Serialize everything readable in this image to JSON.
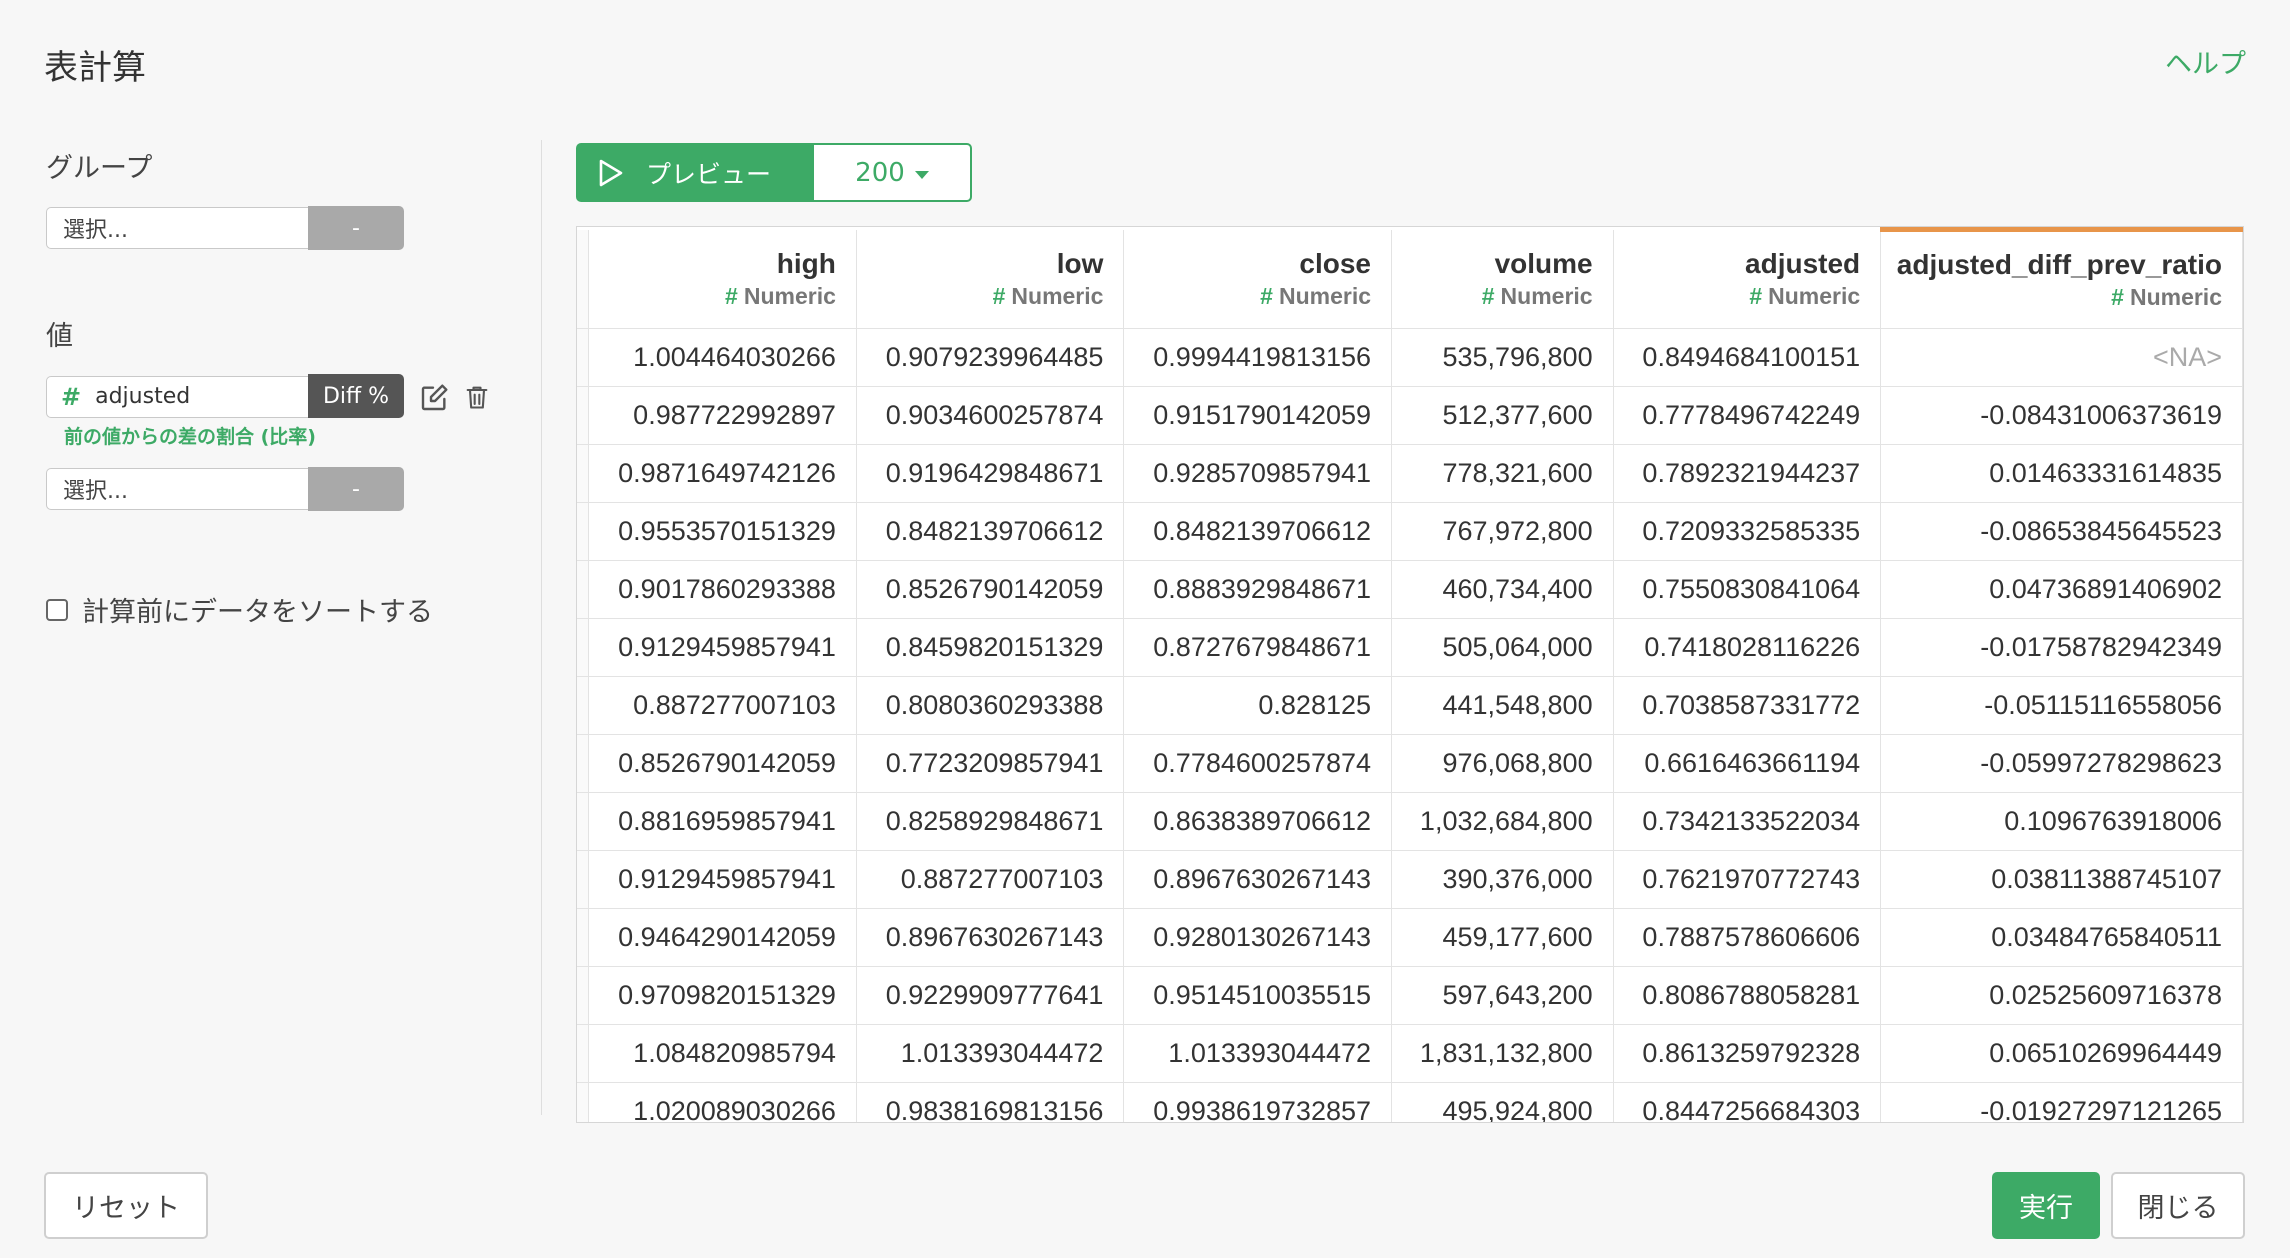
{
  "header": {
    "title": "表計算",
    "help_label": "ヘルプ"
  },
  "group": {
    "label": "グループ",
    "placeholder": "選択...",
    "button": "-"
  },
  "value": {
    "label": "値",
    "column": "adjusted",
    "calc_badge": "Diff %",
    "calc_description": "前の値からの差の割合 (比率)",
    "second_placeholder": "選択...",
    "second_button": "-"
  },
  "sort": {
    "label": "計算前にデータをソートする",
    "checked": false
  },
  "preview": {
    "button_label": "プレビュー",
    "count": "200"
  },
  "table": {
    "columns": [
      {
        "name": "high",
        "type": "Numeric"
      },
      {
        "name": "low",
        "type": "Numeric"
      },
      {
        "name": "close",
        "type": "Numeric"
      },
      {
        "name": "volume",
        "type": "Numeric"
      },
      {
        "name": "adjusted",
        "type": "Numeric"
      },
      {
        "name": "adjusted_diff_prev_ratio",
        "type": "Numeric"
      }
    ],
    "rows": [
      [
        "1.004464030266",
        "0.9079239964485",
        "0.9994419813156",
        "535,796,800",
        "0.8494684100151",
        "<NA>"
      ],
      [
        "0.987722992897",
        "0.9034600257874",
        "0.9151790142059",
        "512,377,600",
        "0.7778496742249",
        "-0.08431006373619"
      ],
      [
        "0.9871649742126",
        "0.9196429848671",
        "0.9285709857941",
        "778,321,600",
        "0.7892321944237",
        "0.01463331614835"
      ],
      [
        "0.9553570151329",
        "0.8482139706612",
        "0.8482139706612",
        "767,972,800",
        "0.7209332585335",
        "-0.08653845645523"
      ],
      [
        "0.9017860293388",
        "0.8526790142059",
        "0.8883929848671",
        "460,734,400",
        "0.7550830841064",
        "0.04736891406902"
      ],
      [
        "0.9129459857941",
        "0.8459820151329",
        "0.8727679848671",
        "505,064,000",
        "0.7418028116226",
        "-0.01758782942349"
      ],
      [
        "0.887277007103",
        "0.8080360293388",
        "0.828125",
        "441,548,800",
        "0.7038587331772",
        "-0.05115116558056"
      ],
      [
        "0.8526790142059",
        "0.7723209857941",
        "0.7784600257874",
        "976,068,800",
        "0.6616463661194",
        "-0.05997278298623"
      ],
      [
        "0.8816959857941",
        "0.8258929848671",
        "0.8638389706612",
        "1,032,684,800",
        "0.7342133522034",
        "0.1096763918006"
      ],
      [
        "0.9129459857941",
        "0.887277007103",
        "0.8967630267143",
        "390,376,000",
        "0.7621970772743",
        "0.03811388745107"
      ],
      [
        "0.9464290142059",
        "0.8967630267143",
        "0.9280130267143",
        "459,177,600",
        "0.7887578606606",
        "0.03484765840511"
      ],
      [
        "0.9709820151329",
        "0.9229909777641",
        "0.9514510035515",
        "597,643,200",
        "0.8086788058281",
        "0.02525609716378"
      ],
      [
        "1.084820985794",
        "1.013393044472",
        "1.013393044472",
        "1,831,132,800",
        "0.8613259792328",
        "0.06510269964449"
      ],
      [
        "1.020089030266",
        "0.9838169813156",
        "0.9938619732857",
        "495,924,800",
        "0.8447256684303",
        "-0.01927297121265"
      ]
    ]
  },
  "footer": {
    "reset_label": "リセット",
    "run_label": "実行",
    "close_label": "閉じる"
  },
  "colors": {
    "accent": "#3daa66",
    "highlight_column": "#e8954a"
  }
}
